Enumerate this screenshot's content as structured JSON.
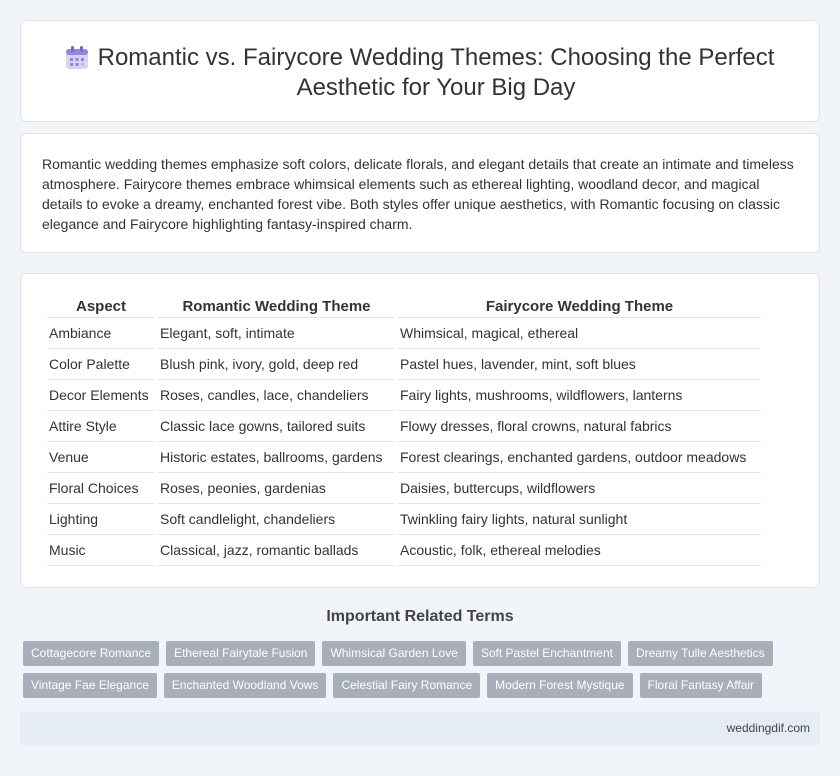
{
  "header": {
    "icon": "calendar-icon",
    "title": "Romantic vs. Fairycore Wedding Themes: Choosing the Perfect Aesthetic for Your Big Day"
  },
  "intro": {
    "text": "Romantic wedding themes emphasize soft colors, delicate florals, and elegant details that create an intimate and timeless atmosphere. Fairycore themes embrace whimsical elements such as ethereal lighting, woodland decor, and magical details to evoke a dreamy, enchanted forest vibe. Both styles offer unique aesthetics, with Romantic focusing on classic elegance and Fairycore highlighting fantasy-inspired charm."
  },
  "table": {
    "headers": [
      "Aspect",
      "Romantic Wedding Theme",
      "Fairycore Wedding Theme"
    ],
    "rows": [
      [
        "Ambiance",
        "Elegant, soft, intimate",
        "Whimsical, magical, ethereal"
      ],
      [
        "Color Palette",
        "Blush pink, ivory, gold, deep red",
        "Pastel hues, lavender, mint, soft blues"
      ],
      [
        "Decor Elements",
        "Roses, candles, lace, chandeliers",
        "Fairy lights, mushrooms, wildflowers, lanterns"
      ],
      [
        "Attire Style",
        "Classic lace gowns, tailored suits",
        "Flowy dresses, floral crowns, natural fabrics"
      ],
      [
        "Venue",
        "Historic estates, ballrooms, gardens",
        "Forest clearings, enchanted gardens, outdoor meadows"
      ],
      [
        "Floral Choices",
        "Roses, peonies, gardenias",
        "Daisies, buttercups, wildflowers"
      ],
      [
        "Lighting",
        "Soft candlelight, chandeliers",
        "Twinkling fairy lights, natural sunlight"
      ],
      [
        "Music",
        "Classical, jazz, romantic ballads",
        "Acoustic, folk, ethereal melodies"
      ]
    ]
  },
  "related": {
    "title": "Important Related Terms",
    "tags_row1": [
      "Cottagecore Romance",
      "Ethereal Fairytale Fusion",
      "Whimsical Garden Love",
      "Soft Pastel Enchantment",
      "Dreamy Tulle Aesthetics"
    ],
    "tags_row2": [
      "Vintage Fae Elegance",
      "Enchanted Woodland Vows",
      "Celestial Fairy Romance",
      "Modern Forest Mystique",
      "Floral Fantasy Affair"
    ]
  },
  "footer": {
    "site": "weddingdif.com"
  },
  "colors": {
    "background": "#f1f4f9",
    "tag": "#a9afb8",
    "footer": "#e6ecf5",
    "icon_accent": "#7b7fd6"
  }
}
